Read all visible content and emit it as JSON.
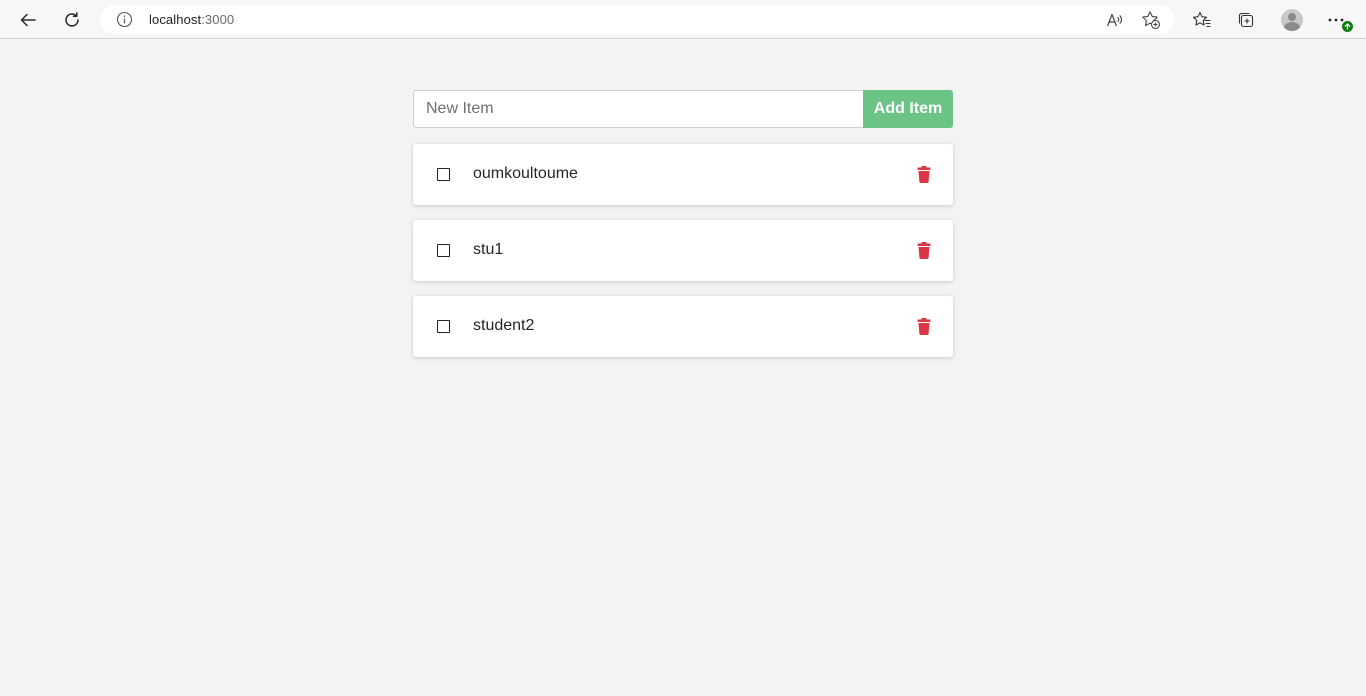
{
  "browser": {
    "url_host": "localhost",
    "url_port": ":3000",
    "icons": {
      "back": "back-arrow-icon",
      "refresh": "refresh-icon",
      "info": "info-icon",
      "read_aloud": "read-aloud-icon",
      "add_favorite": "add-favorite-icon",
      "favorites": "favorites-icon",
      "collections": "collections-icon",
      "profile": "profile-avatar",
      "menu": "more-menu-icon"
    },
    "update_badge_color": "#107c10"
  },
  "app": {
    "input": {
      "value": "",
      "placeholder": "New Item"
    },
    "add_button_label": "Add Item",
    "accent_color": "#6cc386",
    "delete_color": "#dc3545",
    "items": [
      {
        "label": "oumkoultoume",
        "checked": false
      },
      {
        "label": "stu1",
        "checked": false
      },
      {
        "label": "student2",
        "checked": false
      }
    ]
  }
}
